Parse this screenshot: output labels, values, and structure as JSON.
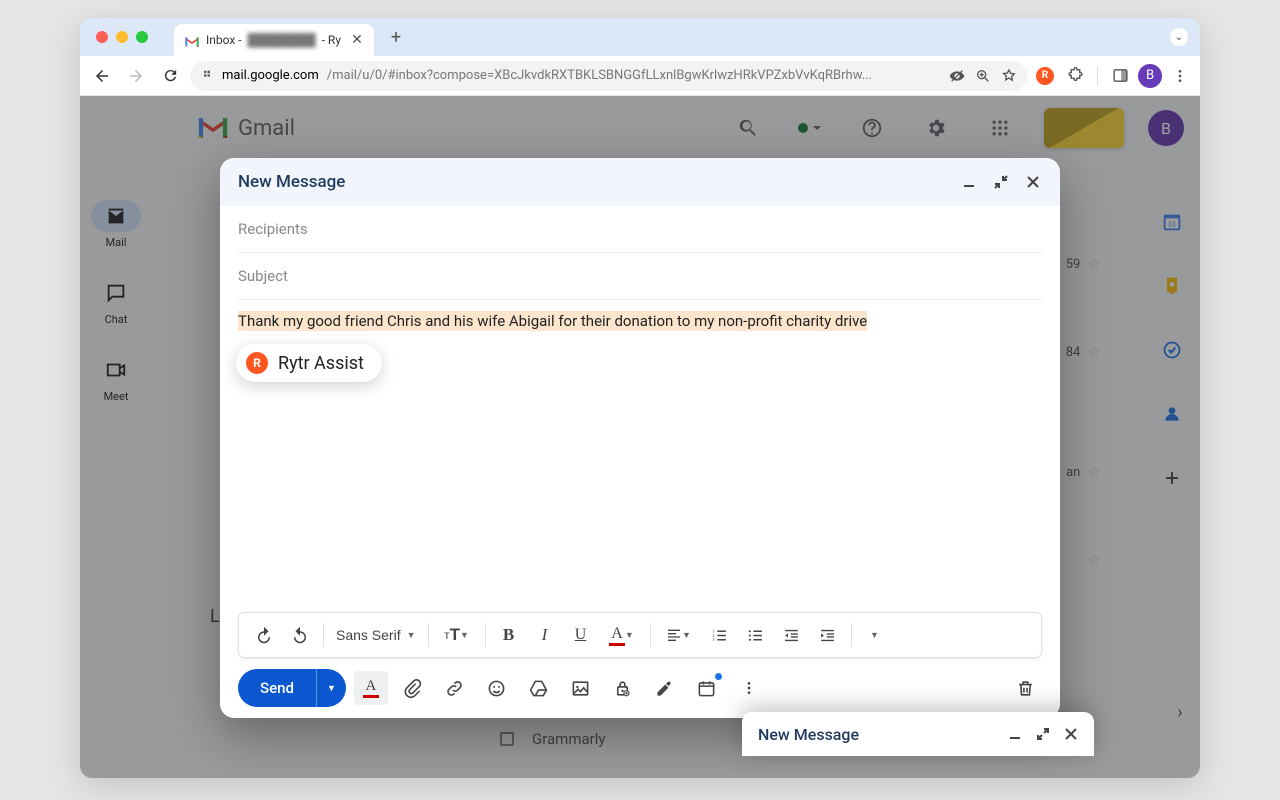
{
  "browser": {
    "tab_title_prefix": "Inbox -",
    "tab_title_suffix": "- Ry",
    "url_host": "mail.google.com",
    "url_path": "/mail/u/0/#inbox?compose=XBcJkvdkRXTBKLSBNGGfLLxnlBgwKrlwzHRkVPZxbVvKqRBrhw..."
  },
  "header": {
    "app_name": "Gmail",
    "avatar_letter": "B"
  },
  "rail": {
    "mail": "Mail",
    "chat": "Chat",
    "meet": "Meet"
  },
  "bg": {
    "row1": "59",
    "row2": "84",
    "row3": "an",
    "grammarly": "Grammarly",
    "label_l": "L"
  },
  "compose": {
    "title": "New Message",
    "recipients_placeholder": "Recipients",
    "subject_placeholder": "Subject",
    "body_highlighted": "Thank my good friend Chris and his wife Abigail for their donation to my non-profit charity drive",
    "rytr_label": "Rytr Assist",
    "font_name": "Sans Serif",
    "send_label": "Send"
  },
  "mini": {
    "title": "New Message"
  }
}
